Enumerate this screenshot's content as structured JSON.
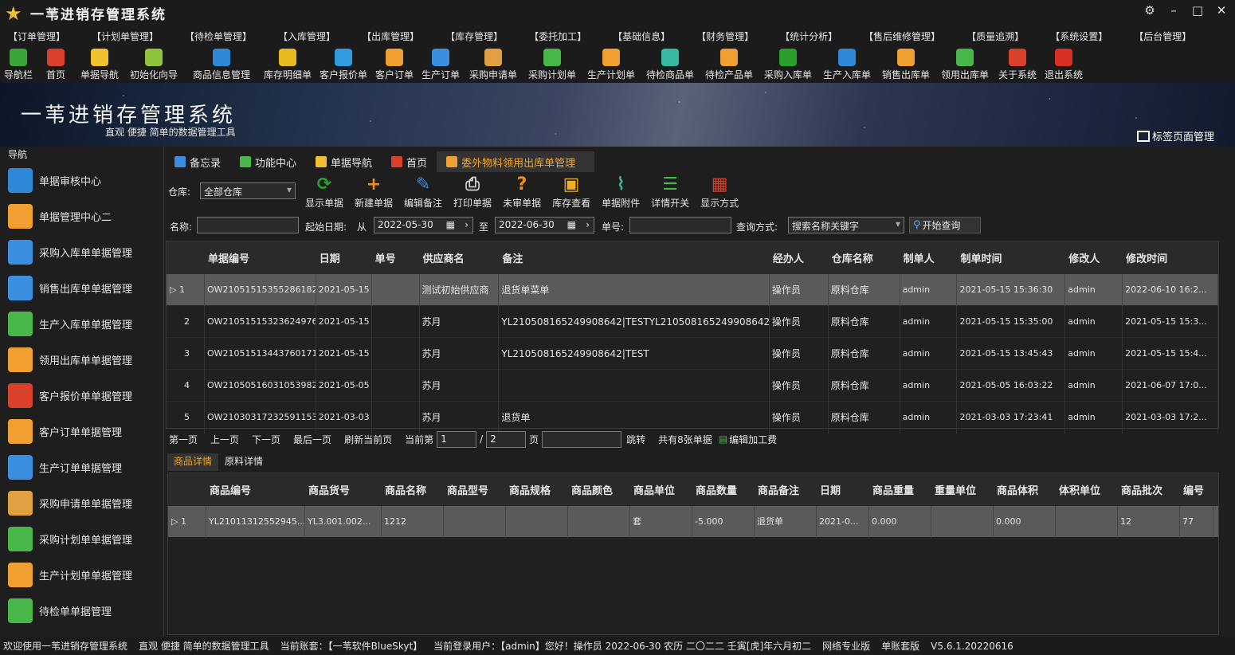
{
  "app": {
    "title": "一苇进销存管理系统"
  },
  "menu": [
    "【订单管理】",
    "【计划单管理】",
    "【待检单管理】",
    "【入库管理】",
    "【出库管理】",
    "【库存管理】",
    "【委托加工】",
    "【基础信息】",
    "【财务管理】",
    "【统计分析】",
    "【售后维修管理】",
    "【质量追溯】",
    "【系统设置】",
    "【后台管理】"
  ],
  "toolbar": [
    {
      "label": "导航栏",
      "icon": "menu-icon",
      "color": "#3aa53a"
    },
    {
      "label": "首页",
      "icon": "home-icon",
      "color": "#d9412b"
    },
    {
      "label": "单据导航",
      "icon": "pen-icon",
      "color": "#f0c030"
    },
    {
      "label": "初始化向导",
      "icon": "wand-icon",
      "color": "#8fc33a"
    },
    {
      "label": "商品信息管理",
      "icon": "cubes-icon",
      "color": "#2f87d8"
    },
    {
      "label": "库存明细单",
      "icon": "warning-icon",
      "color": "#e8b820"
    },
    {
      "label": "客户报价单",
      "icon": "tag-icon",
      "color": "#2f9ce0"
    },
    {
      "label": "客户订单",
      "icon": "doc-icon",
      "color": "#f0a030"
    },
    {
      "label": "生产订单",
      "icon": "doc-icon",
      "color": "#3c8ee0"
    },
    {
      "label": "采购申请单",
      "icon": "mail-icon",
      "color": "#e0a040"
    },
    {
      "label": "采购计划单",
      "icon": "chat-icon",
      "color": "#49b649"
    },
    {
      "label": "生产计划单",
      "icon": "chat-icon",
      "color": "#f0a030"
    },
    {
      "label": "待检商品单",
      "icon": "flask-icon",
      "color": "#38b8a0"
    },
    {
      "label": "待检产品单",
      "icon": "flask-icon",
      "color": "#f0a030"
    },
    {
      "label": "采购入库单",
      "icon": "plus-icon",
      "color": "#2aa02a"
    },
    {
      "label": "生产入库单",
      "icon": "cart-icon",
      "color": "#2f87d8"
    },
    {
      "label": "销售出库单",
      "icon": "out-icon",
      "color": "#f0a030"
    },
    {
      "label": "领用出库单",
      "icon": "download-icon",
      "color": "#49b649"
    },
    {
      "label": "关于系统",
      "icon": "home-icon",
      "color": "#d9412b"
    },
    {
      "label": "退出系统",
      "icon": "exit-icon",
      "color": "#d93025"
    }
  ],
  "banner": {
    "title": "一苇进销存管理系统",
    "subtitle": "直观 便捷 简单的数据管理工具",
    "tab_manager": "标签页面管理"
  },
  "sidebar": {
    "header": "导航",
    "items": [
      {
        "label": "单据审核中心",
        "icon": "grid-icon",
        "color": "#2f87d8"
      },
      {
        "label": "单据管理中心二",
        "icon": "grid-icon",
        "color": "#f0a030"
      },
      {
        "label": "采购入库单单据管理",
        "icon": "arrow-left-icon",
        "color": "#3c8ee0"
      },
      {
        "label": "销售出库单单据管理",
        "icon": "arrow-right-icon",
        "color": "#3c8ee0"
      },
      {
        "label": "生产入库单单据管理",
        "icon": "folder-icon",
        "color": "#49b649"
      },
      {
        "label": "领用出库单单据管理",
        "icon": "house-icon",
        "color": "#f0a030"
      },
      {
        "label": "客户报价单单据管理",
        "icon": "books-icon",
        "color": "#d9412b"
      },
      {
        "label": "客户订单单据管理",
        "icon": "doc-icon",
        "color": "#f0a030"
      },
      {
        "label": "生产订单单据管理",
        "icon": "doc-icon",
        "color": "#3c8ee0"
      },
      {
        "label": "采购申请单单据管理",
        "icon": "mail-icon",
        "color": "#e0a040"
      },
      {
        "label": "采购计划单单据管理",
        "icon": "chat-icon",
        "color": "#49b649"
      },
      {
        "label": "生产计划单单据管理",
        "icon": "chat-icon",
        "color": "#f0a030"
      },
      {
        "label": "待检单单据管理",
        "icon": "doc-icon",
        "color": "#49b649"
      }
    ]
  },
  "tabs": [
    {
      "label": "备忘录",
      "color": "#3c8ee0"
    },
    {
      "label": "功能中心",
      "color": "#49b649"
    },
    {
      "label": "单据导航",
      "color": "#f0c030"
    },
    {
      "label": "首页",
      "color": "#d9412b"
    },
    {
      "label": "委外物料领用出库单管理",
      "color": "#f0a030"
    }
  ],
  "ops": [
    {
      "label": "显示单据",
      "icon": "refresh-icon",
      "color": "#2aa02a",
      "sym": "⟳"
    },
    {
      "label": "新建单据",
      "icon": "plus-icon",
      "color": "#f08c1a",
      "sym": "+"
    },
    {
      "label": "编辑备注",
      "icon": "edit-icon",
      "color": "#3c8ee0",
      "sym": "✎"
    },
    {
      "label": "打印单据",
      "icon": "print-icon",
      "color": "#cfcfcf",
      "sym": "⎙"
    },
    {
      "label": "未审单据",
      "icon": "question-icon",
      "color": "#f08c1a",
      "sym": "?"
    },
    {
      "label": "库存查看",
      "icon": "box-icon",
      "color": "#f0b020",
      "sym": "▣"
    },
    {
      "label": "单据附件",
      "icon": "clip-icon",
      "color": "#38b8a0",
      "sym": "⌇"
    },
    {
      "label": "详情开关",
      "icon": "list-icon",
      "color": "#49b649",
      "sym": "☰"
    },
    {
      "label": "显示方式",
      "icon": "tiles-icon",
      "color": "#d9412b",
      "sym": "▦"
    }
  ],
  "filter": {
    "warehouse_label": "仓库:",
    "warehouse_value": "全部仓库",
    "name_label": "名称:",
    "start_label": "起始日期:",
    "from": "从",
    "start_date": "2022-05-30",
    "to": "至",
    "end_date": "2022-06-30",
    "bill_label": "单号:",
    "query_label": "查询方式:",
    "query_value": "搜索名称关键字",
    "search_btn": "开始查询"
  },
  "grid": {
    "headers": [
      "单据编号",
      "日期",
      "单号",
      "供应商名",
      "备注",
      "经办人",
      "仓库名称",
      "制单人",
      "制单时间",
      "修改人",
      "修改时间"
    ],
    "rows": [
      [
        "1",
        "OW2105151535528618​2",
        "2021-05-15",
        "",
        "测试初始供应商",
        "退货单菜单",
        "操作员",
        "原料仓库",
        "admin",
        "2021-05-15 15:36:30",
        "admin",
        "2022-06-10 16:2..."
      ],
      [
        "2",
        "OW210515153236249769",
        "2021-05-15",
        "",
        "苏月",
        "YL210508165249908642|TESTYL210508165249908642|TEST",
        "操作员",
        "原料仓库",
        "admin",
        "2021-05-15 15:35:00",
        "admin",
        "2021-05-15 15:3..."
      ],
      [
        "3",
        "OW210515134437601710",
        "2021-05-15",
        "",
        "苏月",
        "YL210508165249908642|TEST",
        "操作员",
        "原料仓库",
        "admin",
        "2021-05-15 13:45:43",
        "admin",
        "2021-05-15 15:4..."
      ],
      [
        "4",
        "OW210505160310539826",
        "2021-05-05",
        "",
        "苏月",
        "",
        "操作员",
        "原料仓库",
        "admin",
        "2021-05-05 16:03:22",
        "admin",
        "2021-06-07 17:0..."
      ],
      [
        "5",
        "OW210303172325911535",
        "2021-03-03",
        "",
        "苏月",
        "退货单",
        "操作员",
        "原料仓库",
        "admin",
        "2021-03-03 17:23:41",
        "admin",
        "2021-03-03 17:2..."
      ]
    ]
  },
  "pager": {
    "first": "第一页",
    "prev": "上一页",
    "next": "下一页",
    "last": "最后一页",
    "refresh": "刷新当前页",
    "current_label": "当前第",
    "current": "1",
    "slash": "/",
    "total_pages": "2",
    "page_unit": "页",
    "jump": "跳转",
    "total": "共有8张单据",
    "edit_process": "编辑加工费"
  },
  "bottom_tabs": [
    "商品详情",
    "原料详情"
  ],
  "detail": {
    "headers": [
      "商品编号",
      "商品货号",
      "商品名称",
      "商品型号",
      "商品规格",
      "商品颜色",
      "商品单位",
      "商品数量",
      "商品备注",
      "日期",
      "商品重量",
      "重量单位",
      "商品体积",
      "体积单位",
      "商品批次",
      "编号"
    ],
    "rows": [
      [
        "1",
        "YL21011312552945...",
        "YL3.001.002...",
        "1212",
        "",
        "",
        "",
        "套",
        "-5.000",
        "退货单",
        "2021-0...",
        "0.000",
        "",
        "0.000",
        "",
        "12",
        "77"
      ]
    ]
  },
  "status": [
    "欢迎使用一苇进销存管理系统",
    "直观 便捷 简单的数据管理工具",
    "当前账套：【一苇软件BlueSkyt】",
    "当前登录用户：【admin】您好！操作员  2022-06-30  农历 二〇二二 壬寅[虎]年六月初二",
    "网络专业版",
    "单账套版",
    "V5.6.1.20220616"
  ]
}
